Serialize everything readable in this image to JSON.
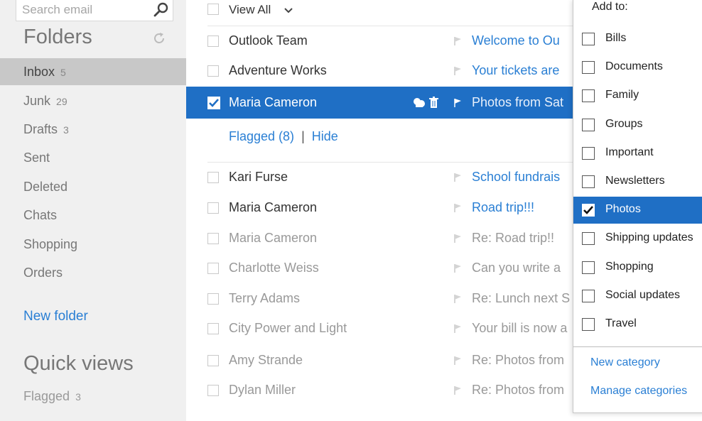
{
  "search": {
    "placeholder": "Search email"
  },
  "sidebar": {
    "folders_title": "Folders",
    "folders": [
      {
        "label": "Inbox",
        "count": "5"
      },
      {
        "label": "Junk",
        "count": "29"
      },
      {
        "label": "Drafts",
        "count": "3"
      },
      {
        "label": "Sent",
        "count": ""
      },
      {
        "label": "Deleted",
        "count": ""
      },
      {
        "label": "Chats",
        "count": ""
      },
      {
        "label": "Shopping",
        "count": ""
      },
      {
        "label": "Orders",
        "count": ""
      }
    ],
    "new_folder": "New folder",
    "quick_views_title": "Quick views",
    "quick_views": [
      {
        "label": "Flagged",
        "count": "3"
      }
    ]
  },
  "list": {
    "view_all": "View All",
    "top_messages": [
      {
        "sender": "Outlook Team",
        "subject": "Welcome to Ou"
      },
      {
        "sender": "Adventure Works",
        "subject": "Your tickets are"
      }
    ],
    "selected_message": {
      "sender": "Maria Cameron",
      "subject": "Photos from Sat"
    },
    "flagged_label": "Flagged (8)",
    "flagged_separator": "|",
    "hide_label": "Hide",
    "messages": [
      {
        "sender": "Kari Furse",
        "subject": "School fundrais"
      },
      {
        "sender": "Maria Cameron",
        "subject": "Road trip!!!"
      },
      {
        "sender": "Maria Cameron",
        "subject": "Re: Road trip!!"
      },
      {
        "sender": "Charlotte Weiss",
        "subject": "Can you write a"
      },
      {
        "sender": "Terry Adams",
        "subject": "Re: Lunch next S"
      },
      {
        "sender": "City Power and Light",
        "subject": "Your bill is now a"
      },
      {
        "sender": "Amy Strande",
        "subject": "Re: Photos from"
      },
      {
        "sender": "Dylan Miller",
        "subject": "Re: Photos from"
      }
    ]
  },
  "category_panel": {
    "title": "Add to:",
    "categories": [
      {
        "label": "Bills"
      },
      {
        "label": "Documents"
      },
      {
        "label": "Family"
      },
      {
        "label": "Groups"
      },
      {
        "label": "Important"
      },
      {
        "label": "Newsletters"
      },
      {
        "label": "Photos"
      },
      {
        "label": "Shipping updates"
      },
      {
        "label": "Shopping"
      },
      {
        "label": "Social updates"
      },
      {
        "label": "Travel"
      }
    ],
    "new_category": "New category",
    "manage_categories": "Manage categories"
  },
  "colors": {
    "accent": "#1f6fc5",
    "link": "#2a7fd4",
    "sidebar_bg": "#f0f0f0"
  }
}
